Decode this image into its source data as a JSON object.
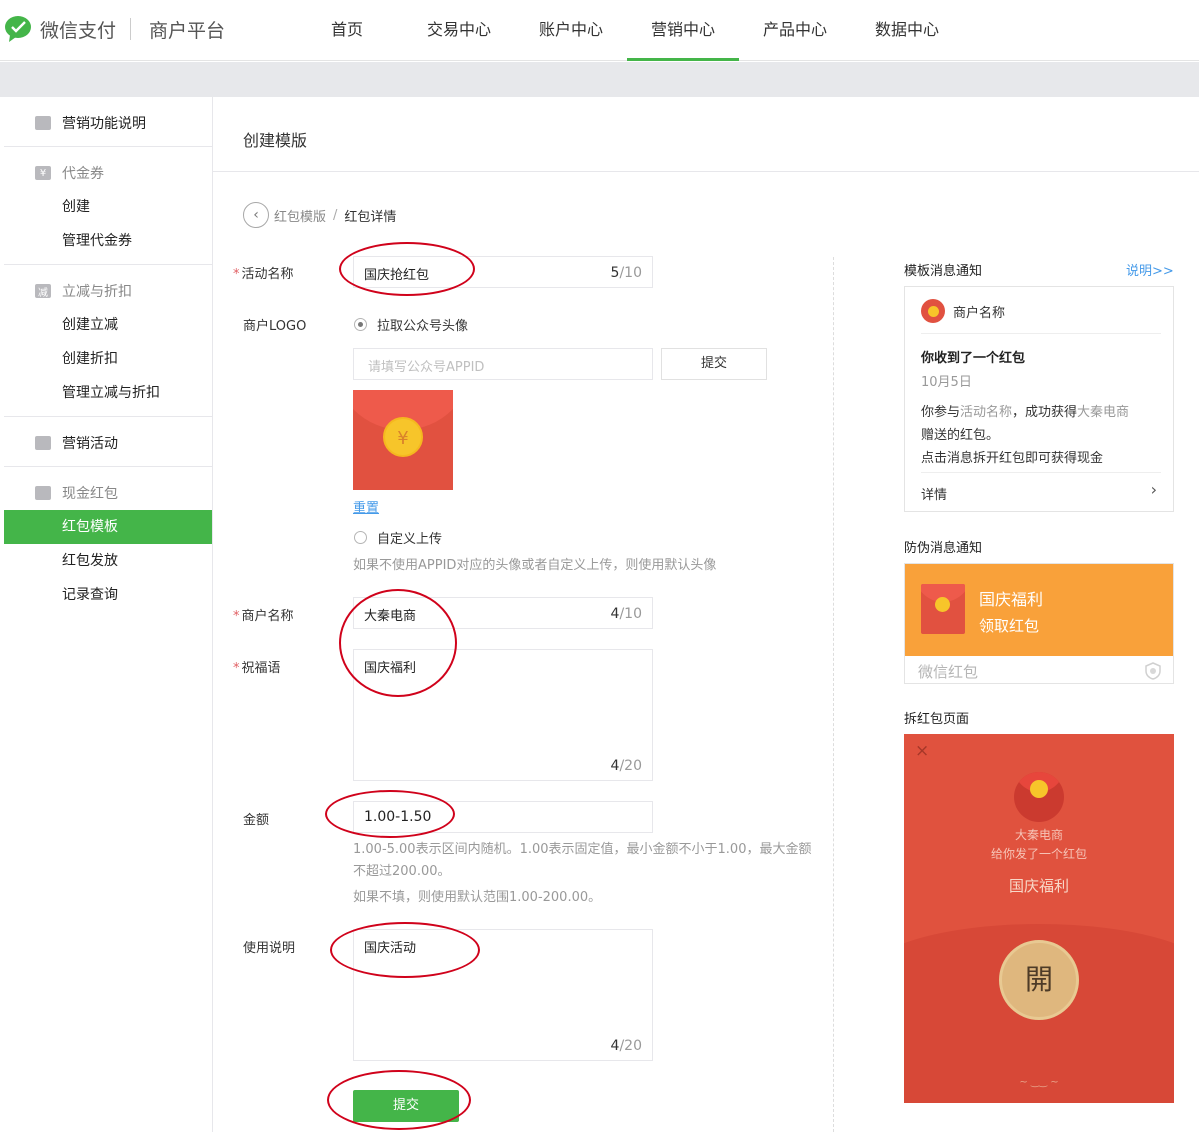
{
  "header": {
    "brand": "微信支付",
    "platform": "商户平台",
    "nav": [
      "首页",
      "交易中心",
      "账户中心",
      "营销中心",
      "产品中心",
      "数据中心"
    ],
    "active_nav": "营销中心"
  },
  "sidebar": {
    "intro": "营销功能说明",
    "coupon": {
      "title": "代金券",
      "icon": "¥",
      "items": [
        "创建",
        "管理代金券"
      ]
    },
    "discount": {
      "title": "立减与折扣",
      "icon": "减",
      "items": [
        "创建立减",
        "创建折扣",
        "管理立减与折扣"
      ]
    },
    "activity": "营销活动",
    "redpack": {
      "title": "现金红包",
      "items": [
        "红包模板",
        "红包发放",
        "记录查询"
      ],
      "active": "红包模板"
    }
  },
  "main": {
    "title": "创建模版",
    "breadcrumb": {
      "back": "‹",
      "parent": "红包模版",
      "sep": "/",
      "current": "红包详情"
    }
  },
  "form": {
    "activity_name": {
      "label": "活动名称",
      "value": "国庆抢红包",
      "count": "5",
      "max": "/10"
    },
    "logo": {
      "label": "商户LOGO",
      "option_pull": "拉取公众号头像",
      "appid_placeholder": "请填写公众号APPID",
      "submit": "提交",
      "coin": "¥",
      "reset": "重置",
      "option_custom": "自定义上传",
      "hint": "如果不使用APPID对应的头像或者自定义上传，则使用默认头像"
    },
    "merchant_name": {
      "label": "商户名称",
      "value": "大秦电商",
      "count": "4",
      "max": "/10"
    },
    "blessing": {
      "label": "祝福语",
      "value": "国庆福利",
      "count": "4",
      "max": "/20"
    },
    "amount": {
      "label": "金额",
      "value": "1.00-1.50",
      "hint1": "1.00-5.00表示区间内随机。1.00表示固定值，最小金额不小于1.00，最大金额",
      "hint2": "不超过200.00。",
      "hint3": "如果不填，则使用默认范围1.00-200.00。"
    },
    "usage": {
      "label": "使用说明",
      "value": "国庆活动",
      "count": "4",
      "max": "/20"
    },
    "submit": "提交",
    "required_mark": "*"
  },
  "preview": {
    "template_title": "模板消息通知",
    "help_link": "说明>>",
    "msg": {
      "merchant": "商户名称",
      "headline": "你收到了一个红包",
      "date": "10月5日",
      "body_1": "你参与",
      "body_activity": "活动名称",
      "body_2": "，成功获得",
      "body_merchant": "大秦电商",
      "body_3": "赠送的红包。",
      "body_4": "点击消息拆开红包即可获得现金",
      "detail": "详情",
      "chevron": "›"
    },
    "anti_title": "防伪消息通知",
    "anti": {
      "title": "国庆福利",
      "action": "领取红包",
      "footer": "微信红包"
    },
    "open_title": "拆红包页面",
    "open": {
      "close": "×",
      "sender": "大秦电商",
      "sub": "给你发了一个红包",
      "blessing": "国庆福利",
      "button": "開",
      "ornament": "~ ‿‿ ~"
    }
  },
  "colors": {
    "accent": "#44b549",
    "red": "#e0523e",
    "orange": "#f9a13a",
    "link": "#459ae9"
  }
}
